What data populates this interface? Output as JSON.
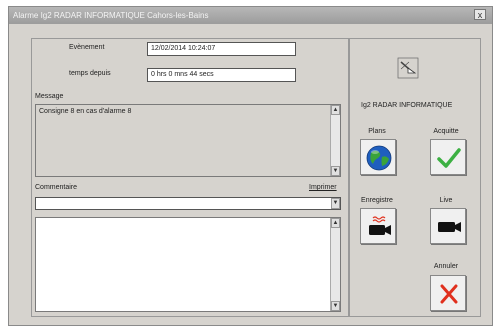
{
  "titlebar": {
    "title": "Alarme    Ig2 RADAR INFORMATIQUE    Cahors-les-Bains",
    "close_glyph": "x"
  },
  "form": {
    "evenement_label": "Evènement",
    "evenement_value": "12/02/2014 10:24:07",
    "temps_label": "temps depuis",
    "temps_value": "0 hrs  0 mns  44 secs",
    "message_label": "Message",
    "message_value": "Consigne 8  en cas d'alarme 8",
    "commentaire_label": "Commentaire",
    "imprimer_label": "Imprimer",
    "commentaire_value": ""
  },
  "right_panel": {
    "station_name": "Ig2 RADAR INFORMATIQUE",
    "buttons": [
      {
        "label": "Plans",
        "icon": "globe-icon"
      },
      {
        "label": "Acquitte",
        "icon": "checkmark-icon"
      },
      {
        "label": "Enregistre",
        "icon": "camera-icon"
      },
      {
        "label": "Live",
        "icon": "camera-icon"
      },
      {
        "label": "Annuler",
        "icon": "cross-icon"
      }
    ]
  },
  "colors": {
    "window_bg": "#d6d3ce",
    "check_green": "#3cb043",
    "cross_red": "#e0301e",
    "globe_blue": "#1f5fbf"
  }
}
